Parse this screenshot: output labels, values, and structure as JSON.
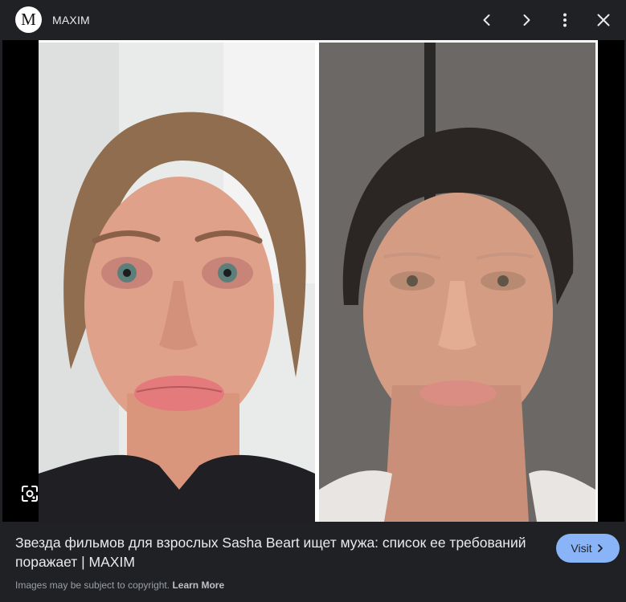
{
  "header": {
    "logo_letter": "M",
    "site_name": "MAXIM",
    "icons": [
      "chevron-left-icon",
      "chevron-right-icon",
      "more-vert-icon",
      "close-icon"
    ]
  },
  "image": {
    "description_icon": "lens-icon"
  },
  "footer": {
    "caption": "Звезда фильмов для взрослых Sasha Beart ищет мужа: список ее требований поражает | MAXIM",
    "visit_label": "Visit",
    "copyright_text": "Images may be subject to copyright.",
    "learn_more_label": "Learn More"
  },
  "colors": {
    "background": "#202124",
    "accent_button": "#8ab4f8",
    "text_primary": "#e8eaed",
    "text_secondary": "#9aa0a6"
  }
}
